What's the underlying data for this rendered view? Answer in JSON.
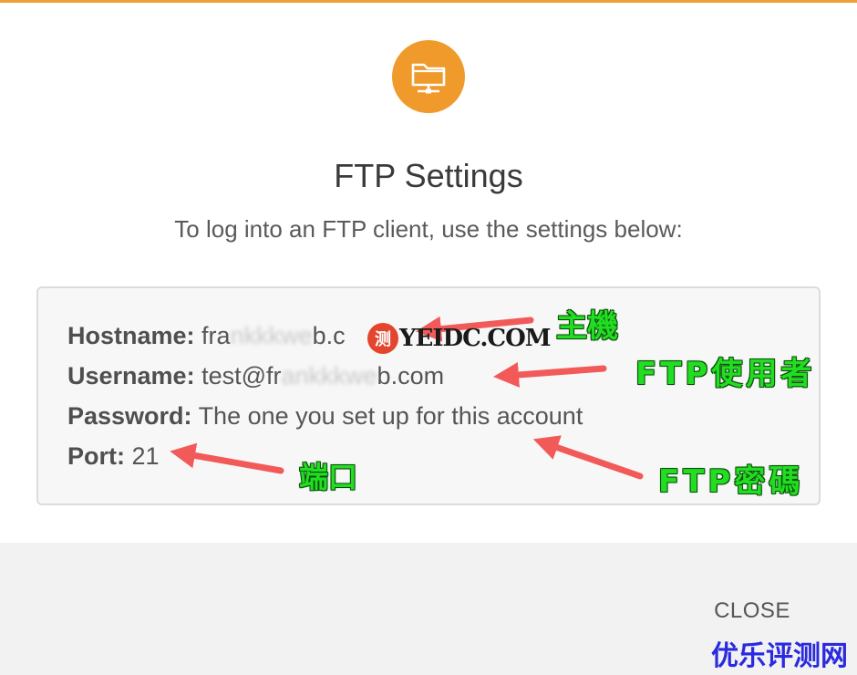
{
  "dialog": {
    "title": "FTP Settings",
    "subtitle": "To log into an FTP client, use the settings below:",
    "icon": "folder-network-icon",
    "accent_color": "#ef9a2a"
  },
  "settings": {
    "hostname_label": "Hostname:",
    "hostname_prefix": "fra",
    "hostname_blurred": "nkkkwe",
    "hostname_suffix": "b.c",
    "username_label": "Username:",
    "username_prefix": "test@fr",
    "username_blurred": "ankkkwe",
    "username_suffix": "b.com",
    "password_label": "Password:",
    "password_value": "The one you set up for this account",
    "port_label": "Port:",
    "port_value": "21"
  },
  "footer": {
    "close_label": "CLOSE"
  },
  "annotations": {
    "host": "主機",
    "user": "FTP使用者",
    "password": "FTP密碼",
    "port": "端口",
    "color": "#22dd22"
  },
  "watermarks": {
    "stamp": "测",
    "site": "YEIDC.COM",
    "bottom": "优乐评测网"
  }
}
